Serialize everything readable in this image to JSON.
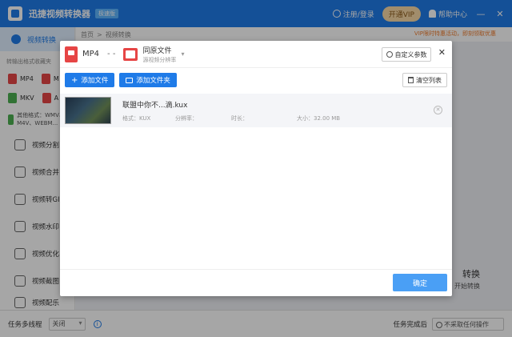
{
  "titlebar": {
    "app_title": "迅捷视频转换器",
    "version_badge": "极速版",
    "login_label": "注册/登录",
    "vip_label": "开通VIP",
    "help_label": "帮助中心",
    "min_label": "—",
    "close_label": "✕"
  },
  "sidebar": {
    "active_label": "视频转换",
    "hint": "转输出格式收藏夹",
    "formats": [
      {
        "label": "MP4",
        "color": "#e64545"
      },
      {
        "label": "M",
        "color": "#e64545"
      },
      {
        "label": "MKV",
        "color": "#4caf50"
      },
      {
        "label": "A",
        "color": "#e64545"
      }
    ],
    "multi_format": "其他格式：WMV、M4V、WEBM...",
    "items": [
      {
        "label": "视频分割",
        "icon": "split-icon"
      },
      {
        "label": "视频合并",
        "icon": "merge-icon"
      },
      {
        "label": "视频转GIF",
        "icon": "gif-icon"
      },
      {
        "label": "视频水印",
        "icon": "watermark-icon"
      },
      {
        "label": "视频优化",
        "icon": "optimize-icon"
      },
      {
        "label": "视频截图",
        "icon": "screenshot-icon"
      },
      {
        "label": "视频配乐",
        "icon": "music-icon"
      }
    ]
  },
  "main": {
    "breadcrumb_home": "首页",
    "breadcrumb_sep": ">",
    "breadcrumb_current": "视频转换",
    "vip_notice": "VIP限时特惠活动，即刻领取优惠",
    "bg_convert": "转换",
    "bg_start": "开始转换"
  },
  "bottombar": {
    "multithread_label": "任务多线程",
    "multithread_value": "关闭",
    "info_icon": "i",
    "complete_label": "任务完成后",
    "complete_value": "不采取任何操作"
  },
  "dialog": {
    "source_format": "MP4",
    "arrow": "- -",
    "device_name": "同原文件",
    "device_sub": "源视频分辨率",
    "custom_label": "自定义参数",
    "close_label": "✕",
    "add_file_label": "添加文件",
    "add_folder_label": "添加文件夹",
    "clear_label": "清空列表",
    "confirm_label": "确定",
    "files": [
      {
        "name": "联盟中你不...滴.kux",
        "format": "格式：KUX",
        "resolution": "分辨率：",
        "duration": "时长：",
        "size": "大小：32.00 MB"
      }
    ]
  }
}
